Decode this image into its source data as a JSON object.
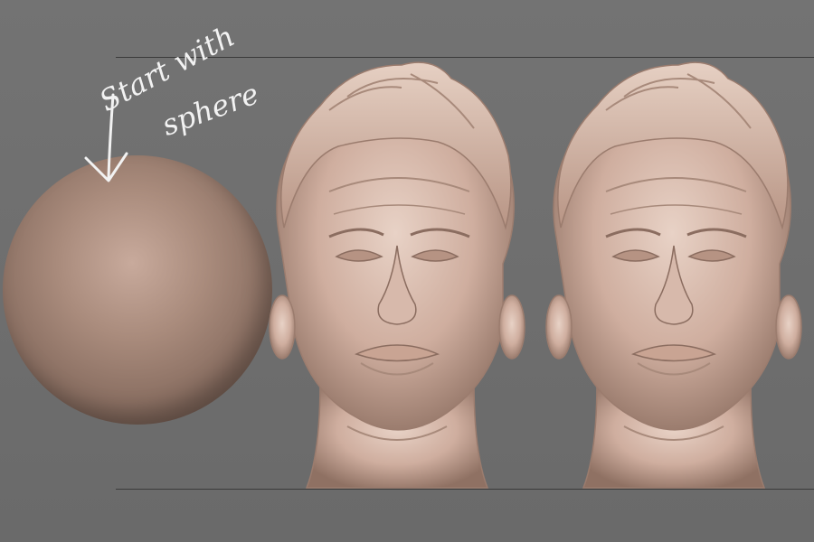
{
  "annotation": {
    "line1": "Start with",
    "line2": "sphere",
    "color": "#f2f2f2"
  },
  "scene": {
    "background": "#6f6f6f",
    "material_color": "#c9a898",
    "objects": [
      "sphere-primitive",
      "sculpted-head-model",
      "sculpted-head-model"
    ]
  }
}
